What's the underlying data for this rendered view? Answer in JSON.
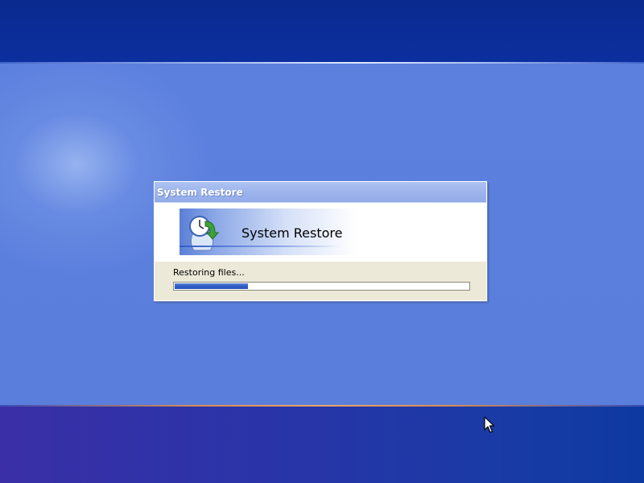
{
  "window": {
    "title": "System Restore"
  },
  "banner": {
    "heading": "System Restore",
    "icon": "system-restore-icon"
  },
  "status": {
    "text": "Restoring files...",
    "progress_fraction": 0.25
  },
  "colors": {
    "desktop": "#5a7edc",
    "top_band": "#0b2f9e",
    "bottom_band": "#2a34a8",
    "dialog_face": "#ece9d8",
    "titlebar": "#9db4ec",
    "progress_fill": "#2f5cc4"
  },
  "cursor": {
    "icon": "arrow-cursor-icon"
  }
}
